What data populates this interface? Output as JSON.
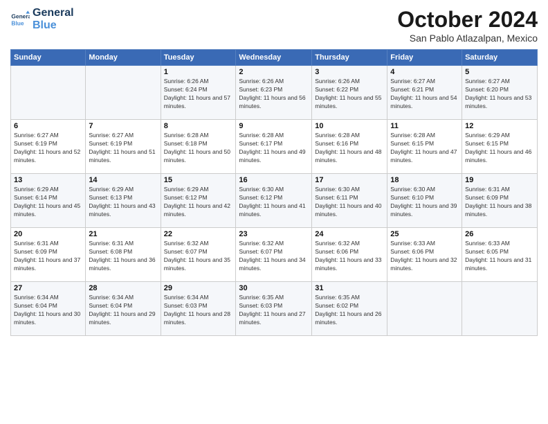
{
  "logo": {
    "line1": "General",
    "line2": "Blue"
  },
  "title": "October 2024",
  "location": "San Pablo Atlazalpan, Mexico",
  "weekdays": [
    "Sunday",
    "Monday",
    "Tuesday",
    "Wednesday",
    "Thursday",
    "Friday",
    "Saturday"
  ],
  "weeks": [
    [
      {
        "day": "",
        "sunrise": "",
        "sunset": "",
        "daylight": ""
      },
      {
        "day": "",
        "sunrise": "",
        "sunset": "",
        "daylight": ""
      },
      {
        "day": "1",
        "sunrise": "Sunrise: 6:26 AM",
        "sunset": "Sunset: 6:24 PM",
        "daylight": "Daylight: 11 hours and 57 minutes."
      },
      {
        "day": "2",
        "sunrise": "Sunrise: 6:26 AM",
        "sunset": "Sunset: 6:23 PM",
        "daylight": "Daylight: 11 hours and 56 minutes."
      },
      {
        "day": "3",
        "sunrise": "Sunrise: 6:26 AM",
        "sunset": "Sunset: 6:22 PM",
        "daylight": "Daylight: 11 hours and 55 minutes."
      },
      {
        "day": "4",
        "sunrise": "Sunrise: 6:27 AM",
        "sunset": "Sunset: 6:21 PM",
        "daylight": "Daylight: 11 hours and 54 minutes."
      },
      {
        "day": "5",
        "sunrise": "Sunrise: 6:27 AM",
        "sunset": "Sunset: 6:20 PM",
        "daylight": "Daylight: 11 hours and 53 minutes."
      }
    ],
    [
      {
        "day": "6",
        "sunrise": "Sunrise: 6:27 AM",
        "sunset": "Sunset: 6:19 PM",
        "daylight": "Daylight: 11 hours and 52 minutes."
      },
      {
        "day": "7",
        "sunrise": "Sunrise: 6:27 AM",
        "sunset": "Sunset: 6:19 PM",
        "daylight": "Daylight: 11 hours and 51 minutes."
      },
      {
        "day": "8",
        "sunrise": "Sunrise: 6:28 AM",
        "sunset": "Sunset: 6:18 PM",
        "daylight": "Daylight: 11 hours and 50 minutes."
      },
      {
        "day": "9",
        "sunrise": "Sunrise: 6:28 AM",
        "sunset": "Sunset: 6:17 PM",
        "daylight": "Daylight: 11 hours and 49 minutes."
      },
      {
        "day": "10",
        "sunrise": "Sunrise: 6:28 AM",
        "sunset": "Sunset: 6:16 PM",
        "daylight": "Daylight: 11 hours and 48 minutes."
      },
      {
        "day": "11",
        "sunrise": "Sunrise: 6:28 AM",
        "sunset": "Sunset: 6:15 PM",
        "daylight": "Daylight: 11 hours and 47 minutes."
      },
      {
        "day": "12",
        "sunrise": "Sunrise: 6:29 AM",
        "sunset": "Sunset: 6:15 PM",
        "daylight": "Daylight: 11 hours and 46 minutes."
      }
    ],
    [
      {
        "day": "13",
        "sunrise": "Sunrise: 6:29 AM",
        "sunset": "Sunset: 6:14 PM",
        "daylight": "Daylight: 11 hours and 45 minutes."
      },
      {
        "day": "14",
        "sunrise": "Sunrise: 6:29 AM",
        "sunset": "Sunset: 6:13 PM",
        "daylight": "Daylight: 11 hours and 43 minutes."
      },
      {
        "day": "15",
        "sunrise": "Sunrise: 6:29 AM",
        "sunset": "Sunset: 6:12 PM",
        "daylight": "Daylight: 11 hours and 42 minutes."
      },
      {
        "day": "16",
        "sunrise": "Sunrise: 6:30 AM",
        "sunset": "Sunset: 6:12 PM",
        "daylight": "Daylight: 11 hours and 41 minutes."
      },
      {
        "day": "17",
        "sunrise": "Sunrise: 6:30 AM",
        "sunset": "Sunset: 6:11 PM",
        "daylight": "Daylight: 11 hours and 40 minutes."
      },
      {
        "day": "18",
        "sunrise": "Sunrise: 6:30 AM",
        "sunset": "Sunset: 6:10 PM",
        "daylight": "Daylight: 11 hours and 39 minutes."
      },
      {
        "day": "19",
        "sunrise": "Sunrise: 6:31 AM",
        "sunset": "Sunset: 6:09 PM",
        "daylight": "Daylight: 11 hours and 38 minutes."
      }
    ],
    [
      {
        "day": "20",
        "sunrise": "Sunrise: 6:31 AM",
        "sunset": "Sunset: 6:09 PM",
        "daylight": "Daylight: 11 hours and 37 minutes."
      },
      {
        "day": "21",
        "sunrise": "Sunrise: 6:31 AM",
        "sunset": "Sunset: 6:08 PM",
        "daylight": "Daylight: 11 hours and 36 minutes."
      },
      {
        "day": "22",
        "sunrise": "Sunrise: 6:32 AM",
        "sunset": "Sunset: 6:07 PM",
        "daylight": "Daylight: 11 hours and 35 minutes."
      },
      {
        "day": "23",
        "sunrise": "Sunrise: 6:32 AM",
        "sunset": "Sunset: 6:07 PM",
        "daylight": "Daylight: 11 hours and 34 minutes."
      },
      {
        "day": "24",
        "sunrise": "Sunrise: 6:32 AM",
        "sunset": "Sunset: 6:06 PM",
        "daylight": "Daylight: 11 hours and 33 minutes."
      },
      {
        "day": "25",
        "sunrise": "Sunrise: 6:33 AM",
        "sunset": "Sunset: 6:06 PM",
        "daylight": "Daylight: 11 hours and 32 minutes."
      },
      {
        "day": "26",
        "sunrise": "Sunrise: 6:33 AM",
        "sunset": "Sunset: 6:05 PM",
        "daylight": "Daylight: 11 hours and 31 minutes."
      }
    ],
    [
      {
        "day": "27",
        "sunrise": "Sunrise: 6:34 AM",
        "sunset": "Sunset: 6:04 PM",
        "daylight": "Daylight: 11 hours and 30 minutes."
      },
      {
        "day": "28",
        "sunrise": "Sunrise: 6:34 AM",
        "sunset": "Sunset: 6:04 PM",
        "daylight": "Daylight: 11 hours and 29 minutes."
      },
      {
        "day": "29",
        "sunrise": "Sunrise: 6:34 AM",
        "sunset": "Sunset: 6:03 PM",
        "daylight": "Daylight: 11 hours and 28 minutes."
      },
      {
        "day": "30",
        "sunrise": "Sunrise: 6:35 AM",
        "sunset": "Sunset: 6:03 PM",
        "daylight": "Daylight: 11 hours and 27 minutes."
      },
      {
        "day": "31",
        "sunrise": "Sunrise: 6:35 AM",
        "sunset": "Sunset: 6:02 PM",
        "daylight": "Daylight: 11 hours and 26 minutes."
      },
      {
        "day": "",
        "sunrise": "",
        "sunset": "",
        "daylight": ""
      },
      {
        "day": "",
        "sunrise": "",
        "sunset": "",
        "daylight": ""
      }
    ]
  ]
}
